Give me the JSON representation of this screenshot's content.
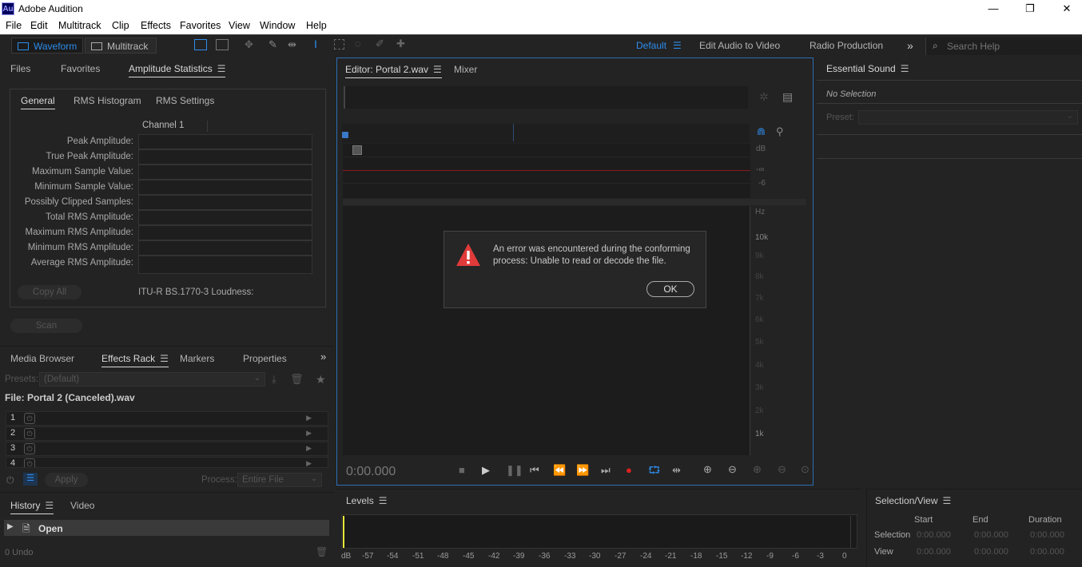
{
  "window": {
    "app_icon": "Au",
    "title": "Adobe Audition",
    "minimize": "—",
    "maximize": "❐",
    "close": "✕"
  },
  "menu": [
    "File",
    "Edit",
    "Multitrack",
    "Clip",
    "Effects",
    "Favorites",
    "View",
    "Window",
    "Help"
  ],
  "toolbar": {
    "waveform": "Waveform",
    "multitrack": "Multitrack",
    "workspaces": [
      "Default",
      "Edit Audio to Video",
      "Radio Production"
    ],
    "more": "»",
    "search_placeholder": "Search Help"
  },
  "left_top": {
    "tabs": [
      "Files",
      "Favorites",
      "Amplitude Statistics"
    ],
    "subtabs": [
      "General",
      "RMS Histogram",
      "RMS Settings"
    ],
    "channel": "Channel 1",
    "rows": [
      "Peak Amplitude:",
      "True Peak Amplitude:",
      "Maximum Sample Value:",
      "Minimum Sample Value:",
      "Possibly Clipped Samples:",
      "Total RMS Amplitude:",
      "Maximum RMS Amplitude:",
      "Minimum RMS Amplitude:",
      "Average RMS Amplitude:"
    ],
    "copy_all": "Copy All",
    "loudness": "ITU-R BS.1770-3 Loudness:",
    "scan": "Scan"
  },
  "effects": {
    "tabs": [
      "Media Browser",
      "Effects Rack",
      "Markers",
      "Properties"
    ],
    "presets_label": "Presets:",
    "presets_value": "(Default)",
    "file": "File: Portal 2 (Canceled).wav",
    "slots": [
      "1",
      "2",
      "3",
      "4"
    ],
    "apply": "Apply",
    "process_label": "Process:",
    "process_value": "Entire File"
  },
  "history": {
    "tabs": [
      "History",
      "Video"
    ],
    "item": "Open",
    "undo": "0 Undo"
  },
  "editor": {
    "tabs": [
      "Editor: Portal 2.wav",
      "Mixer"
    ],
    "db_label": "dB",
    "db_inf": "-∞",
    "db_6": "-6",
    "hz_label": "Hz",
    "hz_ticks": [
      "10k",
      "9k",
      "8k",
      "7k",
      "6k",
      "5k",
      "4k",
      "3k",
      "2k",
      "1k"
    ],
    "time": "0:00.000"
  },
  "dialog": {
    "message": "An error was encountered during the conforming process: Unable to read or decode the file.",
    "ok": "OK"
  },
  "essential": {
    "title": "Essential Sound",
    "status": "No Selection",
    "preset_label": "Preset:"
  },
  "levels": {
    "title": "Levels",
    "scale": [
      "dB",
      "-57",
      "-54",
      "-51",
      "-48",
      "-45",
      "-42",
      "-39",
      "-36",
      "-33",
      "-30",
      "-27",
      "-24",
      "-21",
      "-18",
      "-15",
      "-12",
      "-9",
      "-6",
      "-3",
      "0"
    ]
  },
  "selection": {
    "title": "Selection/View",
    "cols": [
      "Start",
      "End",
      "Duration"
    ],
    "rows": [
      {
        "label": "Selection",
        "start": "0:00.000",
        "end": "0:00.000",
        "duration": "0:00.000"
      },
      {
        "label": "View",
        "start": "0:00.000",
        "end": "0:00.000",
        "duration": "0:00.000"
      }
    ]
  },
  "colors": {
    "accent": "#2d8ceb",
    "record": "#e02020",
    "alert": "#e03a3a",
    "playhead": "#e8e83a"
  }
}
